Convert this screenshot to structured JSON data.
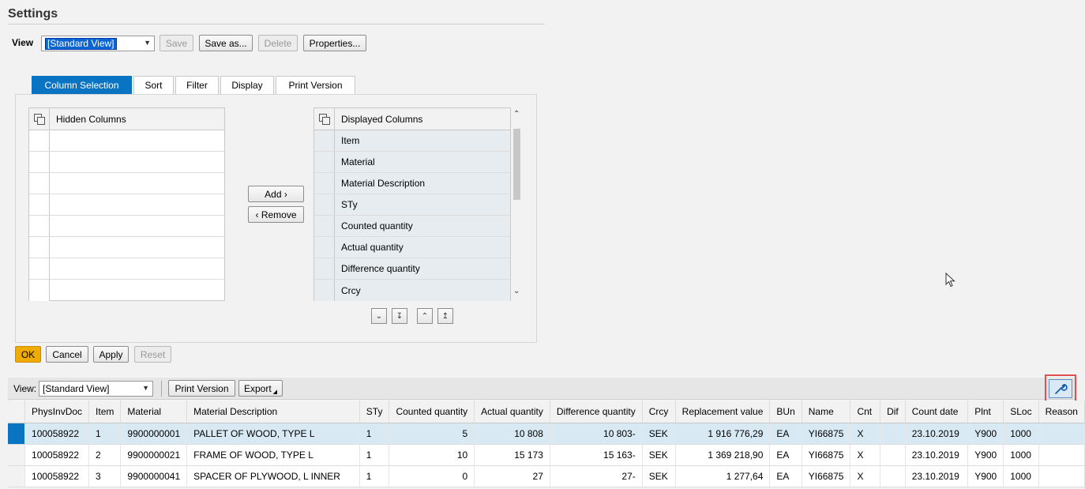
{
  "header": {
    "title": "Settings"
  },
  "view_bar": {
    "label": "View",
    "selected": "[Standard View]",
    "buttons": {
      "save": "Save",
      "save_as": "Save as...",
      "delete": "Delete",
      "properties": "Properties..."
    }
  },
  "tabs": [
    "Column Selection",
    "Sort",
    "Filter",
    "Display",
    "Print Version"
  ],
  "hidden_columns": {
    "header": "Hidden Columns",
    "items": [
      "",
      "",
      "",
      "",
      "",
      "",
      "",
      ""
    ]
  },
  "displayed_columns": {
    "header": "Displayed Columns",
    "items": [
      "Item",
      "Material",
      "Material Description",
      "STy",
      "Counted quantity",
      "Actual quantity",
      "Difference quantity",
      "Crcy"
    ]
  },
  "transfer": {
    "add": "Add",
    "remove": "Remove"
  },
  "dialog_buttons": {
    "ok": "OK",
    "cancel": "Cancel",
    "apply": "Apply",
    "reset": "Reset"
  },
  "table_toolbar": {
    "view_label": "View:",
    "view_selected": "[Standard View]",
    "print": "Print Version",
    "export": "Export"
  },
  "table": {
    "columns": [
      "PhysInvDoc",
      "Item",
      "Material",
      "Material Description",
      "STy",
      "Counted quantity",
      "Actual quantity",
      "Difference quantity",
      "Crcy",
      "Replacement value",
      "BUn",
      "Name",
      "Cnt",
      "Dif",
      "Count date",
      "Plnt",
      "SLoc",
      "Reason"
    ],
    "rows": [
      [
        "100058922",
        "1",
        "9900000001",
        "PALLET OF WOOD, TYPE L",
        "1",
        "5",
        "10 808",
        "10 803-",
        "SEK",
        "1 916 776,29",
        "EA",
        "YI66875",
        "X",
        "",
        "23.10.2019",
        "Y900",
        "1000",
        ""
      ],
      [
        "100058922",
        "2",
        "9900000021",
        "FRAME OF WOOD, TYPE L",
        "1",
        "10",
        "15 173",
        "15 163-",
        "SEK",
        "1 369 218,90",
        "EA",
        "YI66875",
        "X",
        "",
        "23.10.2019",
        "Y900",
        "1000",
        ""
      ],
      [
        "100058922",
        "3",
        "9900000041",
        "SPACER OF PLYWOOD, L INNER",
        "1",
        "0",
        "27",
        "27-",
        "SEK",
        "1 277,64",
        "EA",
        "YI66875",
        "X",
        "",
        "23.10.2019",
        "Y900",
        "1000",
        ""
      ]
    ],
    "selected_row": 0,
    "numeric_columns": [
      5,
      6,
      7,
      9
    ]
  }
}
